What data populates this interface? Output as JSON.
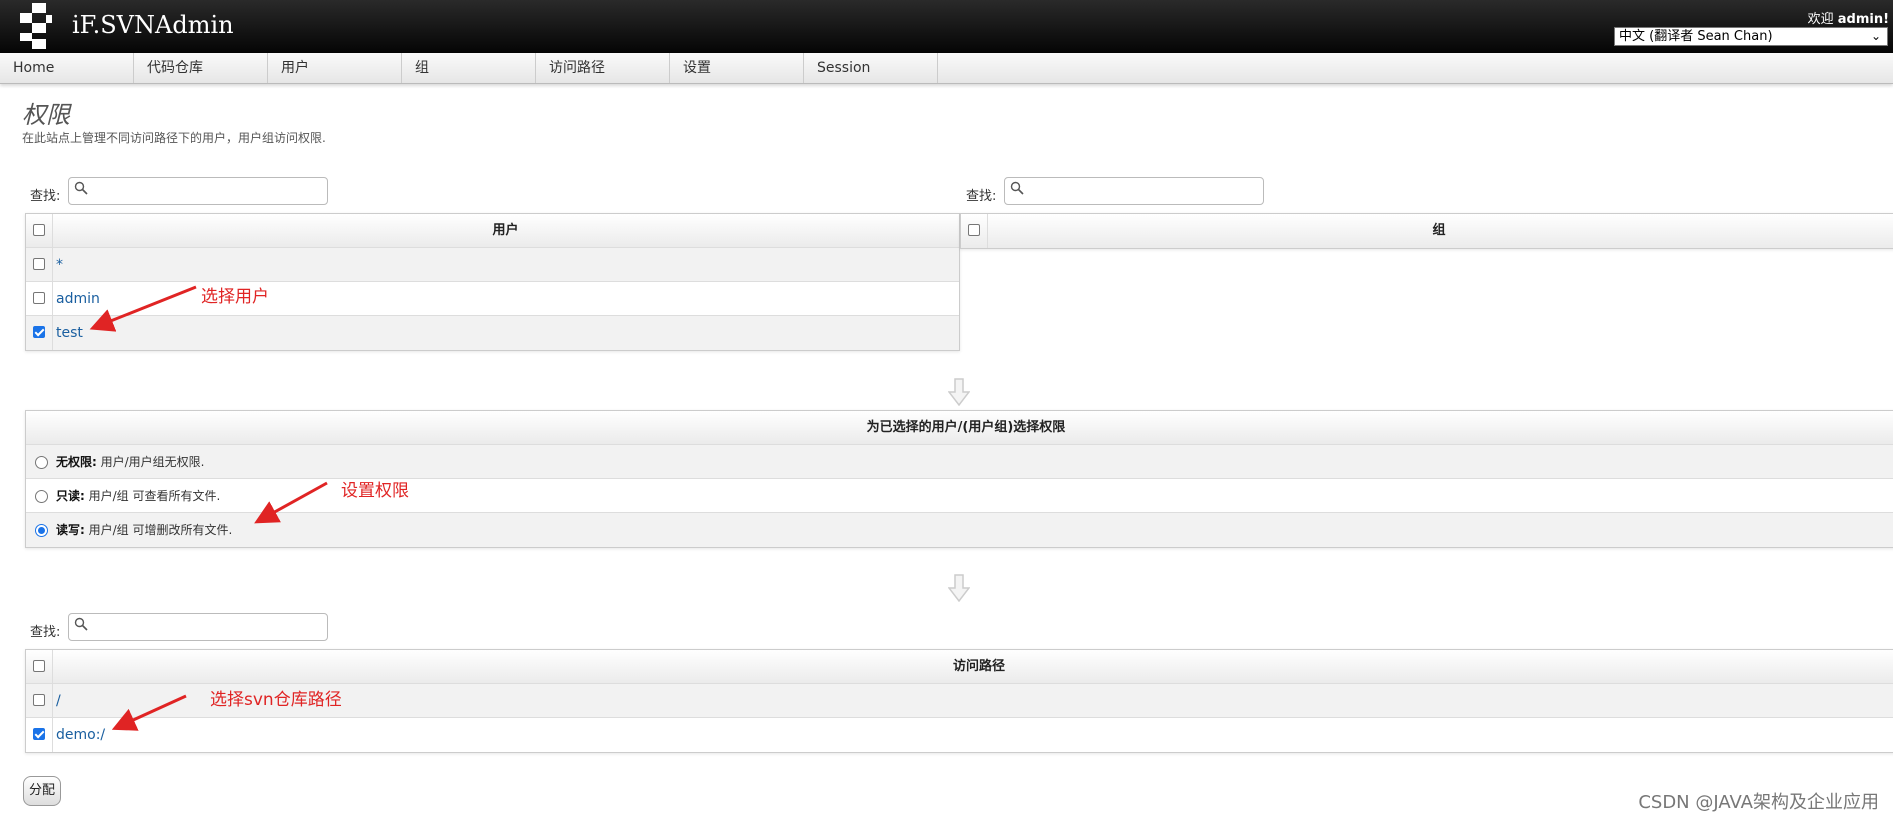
{
  "header": {
    "app_title": "iF.SVNAdmin",
    "welcome_prefix": "欢迎",
    "username": "admin!",
    "language": "中文 (翻译者 Sean Chan)"
  },
  "nav": [
    "Home",
    "代码仓库",
    "用户",
    "组",
    "访问路径",
    "设置",
    "Session"
  ],
  "page": {
    "title": "权限",
    "description": "在此站点上管理不同访问路径下的用户，用户组访问权限."
  },
  "search_label": "查找:",
  "users_table": {
    "header": "用户",
    "rows": [
      {
        "name": "*",
        "checked": false
      },
      {
        "name": "admin",
        "checked": false
      },
      {
        "name": "test",
        "checked": true
      }
    ]
  },
  "groups_table": {
    "header": "组"
  },
  "permissions": {
    "header": "为已选择的用户/(用户组)选择权限",
    "options": [
      {
        "label": "无权限:",
        "desc": "用户/用户组无权限.",
        "selected": false
      },
      {
        "label": "只读:",
        "desc": "用户/组 可查看所有文件.",
        "selected": false
      },
      {
        "label": "读写:",
        "desc": "用户/组 可增删改所有文件.",
        "selected": true
      }
    ]
  },
  "paths_table": {
    "header": "访问路径",
    "rows": [
      {
        "name": "/",
        "checked": false
      },
      {
        "name": "demo:/",
        "checked": true
      }
    ]
  },
  "assign_button": "分配",
  "annotations": {
    "select_user": "选择用户",
    "set_permission": "设置权限",
    "select_repo_path": "选择svn仓库路径"
  },
  "watermark": "CSDN @JAVA架构及企业应用",
  "colors": {
    "link": "#1a5fa0",
    "annotation": "#e02424",
    "header_bg": "#111111"
  }
}
